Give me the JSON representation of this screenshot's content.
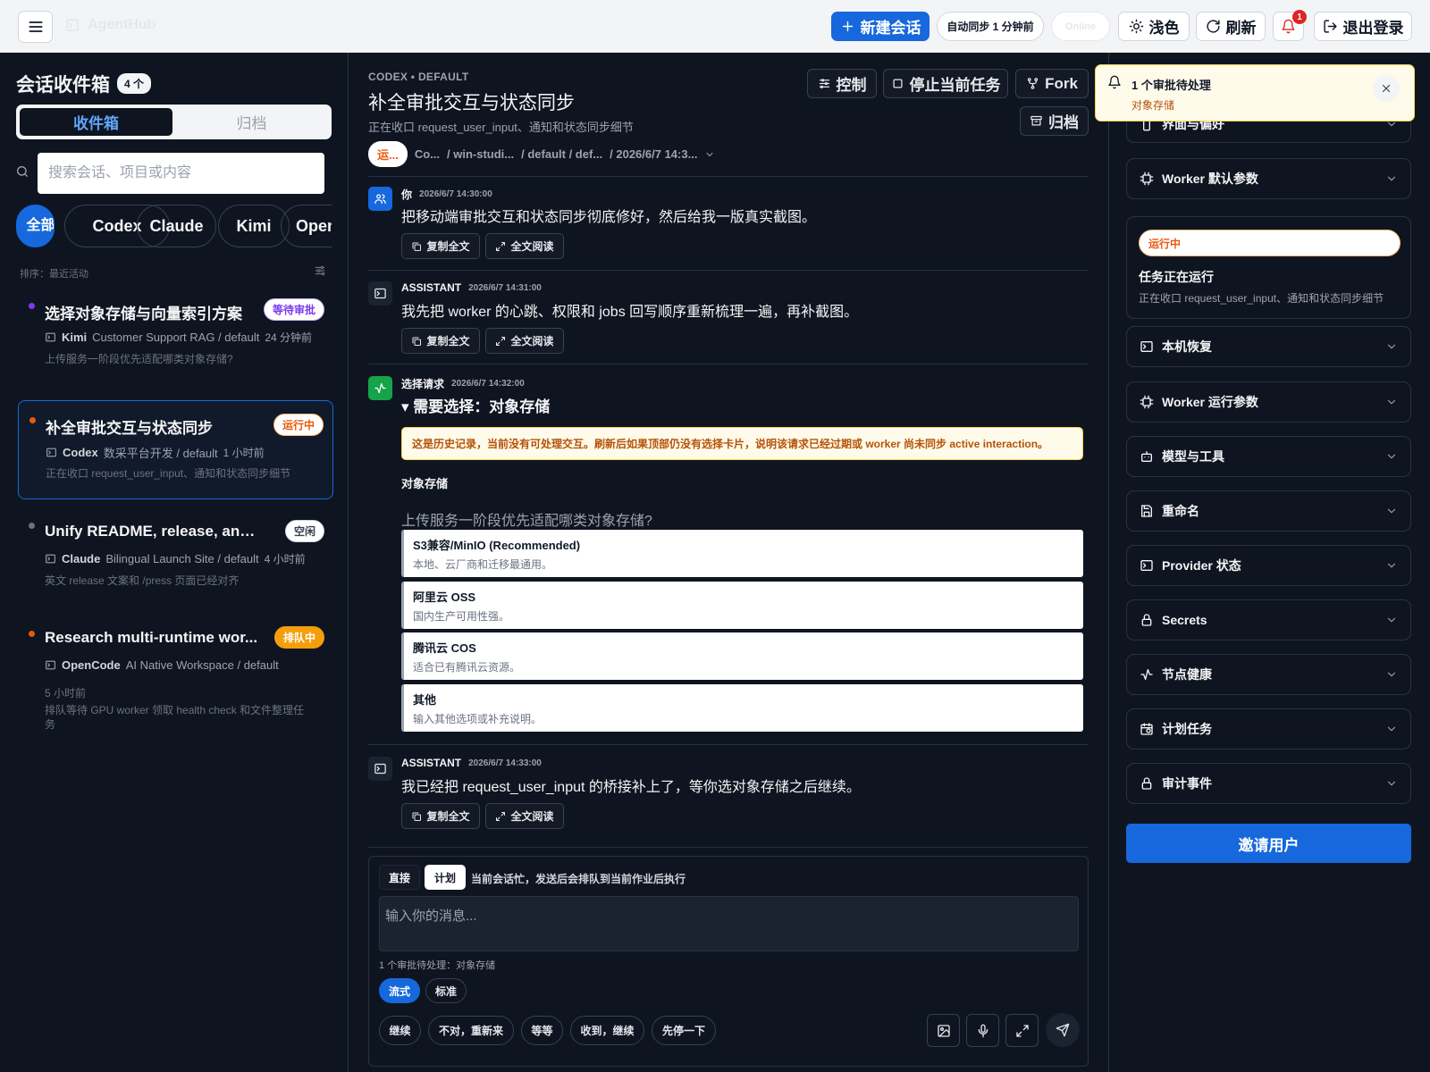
{
  "header": {
    "logo_text": "AgentHub",
    "new_chat": "新建会话",
    "sync_status": "自动同步 1 分钟前",
    "ghost_pill": "Online",
    "theme": "浅色",
    "refresh": "刷新",
    "notifications_count": "1",
    "logout": "退出登录"
  },
  "sidebar": {
    "title": "会话收件箱",
    "count": "4 个",
    "tab_inbox": "收件箱",
    "tab_archive": "归档",
    "search_placeholder": "搜索会话、项目或内容",
    "filters": [
      "全部",
      "Codex",
      "Claude",
      "Kimi",
      "OpenCode"
    ],
    "sort_label": "排序：最近活动",
    "sessions": [
      {
        "title": "选择对象存储与向量索引方案",
        "badge": "等待审批",
        "runtime": "Kimi",
        "project": "Customer Support RAG / default",
        "time": "24 分钟前",
        "preview": "上传服务一阶段优先适配哪类对象存储?"
      },
      {
        "title": "补全审批交互与状态同步",
        "badge": "运行中",
        "runtime": "Codex",
        "project": "数采平台开发 / default",
        "time": "1 小时前",
        "preview": "正在收口 request_user_input、通知和状态同步细节"
      },
      {
        "title": "Unify README, release, and ...",
        "badge": "空闲",
        "runtime": "Claude",
        "project": "Bilingual Launch Site / default",
        "time": "4 小时前",
        "preview": "英文 release 文案和 /press 页面已经对齐"
      },
      {
        "title": "Research multi-runtime wor...",
        "badge": "排队中",
        "runtime": "OpenCode",
        "project": "AI Native Workspace / default",
        "time": "5 小时前",
        "preview": "排队等待 GPU worker 领取 health check 和文件整理任务"
      }
    ],
    "colors": {
      "purple": "#7c3aed",
      "orange": "#ea580c",
      "gray": "#6b7280"
    }
  },
  "conversation": {
    "crumb": "CODEX • DEFAULT",
    "title": "补全审批交互与状态同步",
    "subtitle": "正在收口 request_user_input、通知和状态同步细节",
    "control": "控制",
    "stop": "停止当前任务",
    "fork": "Fork",
    "archive": "归档",
    "path_status": "运...",
    "path": [
      "Co...",
      "/ win-studi...",
      "/ default / def...",
      "/ 2026/6/7 14:3..."
    ],
    "messages": [
      {
        "role": "你",
        "time": "2026/6/7 14:30:00",
        "text": "把移动端审批交互和状态同步彻底修好，然后给我一版真实截图。"
      },
      {
        "role": "ASSISTANT",
        "time": "2026/6/7 14:31:00",
        "text": "我先把 worker 的心跳、权限和 jobs 回写顺序重新梳理一遍，再补截图。"
      },
      {
        "role": "ASSISTANT",
        "time": "2026/6/7 14:33:00",
        "text": "我已经把 request_user_input 的桥接补上了，等你选对象存储之后继续。"
      }
    ],
    "copy_all": "复制全文",
    "read_all": "全文阅读",
    "choice": {
      "role": "选择请求",
      "time": "2026/6/7 14:32:00",
      "title": "▾ 需要选择：对象存储",
      "history_note": "这是历史记录，当前没有可处理交互。刷新后如果顶部仍没有选择卡片，说明该请求已经过期或 worker 尚未同步 active interaction。",
      "label": "对象存储",
      "question": "上传服务一阶段优先适配哪类对象存储?",
      "options": [
        {
          "label": "S3兼容/MinIO (Recommended)",
          "desc": "本地、云厂商和迁移最通用。"
        },
        {
          "label": "阿里云 OSS",
          "desc": "国内生产可用性强。"
        },
        {
          "label": "腾讯云 COS",
          "desc": "适合已有腾讯云资源。"
        },
        {
          "label": "其他",
          "desc": "输入其他选项或补充说明。"
        }
      ]
    }
  },
  "composer": {
    "mode_direct": "直接",
    "mode_plan": "计划",
    "mode_hint": "当前会话忙，发送后会排队到当前作业后执行",
    "placeholder": "输入你的消息...",
    "pending_note": "1 个审批待处理：对象存储",
    "stream": "流式",
    "standard": "标准",
    "quick_replies": [
      "继续",
      "不对，重新来",
      "等等",
      "收到，继续",
      "先停一下"
    ]
  },
  "right_panel": {
    "sections": [
      "界面与偏好",
      "Worker 默认参数",
      "本机恢复",
      "Worker 运行参数",
      "模型与工具",
      "重命名",
      "Provider 状态",
      "Secrets",
      "节点健康",
      "计划任务",
      "审计事件"
    ],
    "run_status": "运行中",
    "run_title": "任务正在运行",
    "run_desc": "正在收口 request_user_input、通知和状态同步细节",
    "invite": "邀请用户"
  },
  "toast": {
    "title": "1 个审批待处理",
    "subtitle": "对象存储"
  },
  "accent": "#1668dc"
}
